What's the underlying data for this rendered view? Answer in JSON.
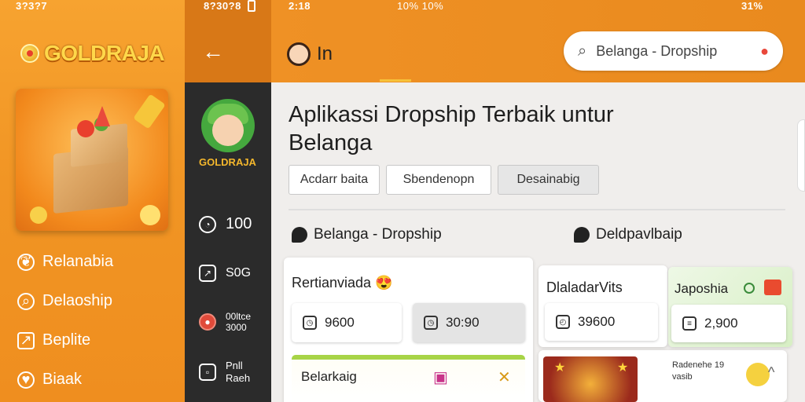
{
  "status": {
    "left_time": "3?3?7",
    "mid_time": "8?30?8",
    "main_time": "2:18",
    "main_indicators": "10%    10%",
    "right_battery": "31%"
  },
  "left_panel": {
    "brand": "GOLDRAJA",
    "menu": [
      {
        "label": "Relanabia",
        "icon": "leaf-icon"
      },
      {
        "label": "Delaoship",
        "icon": "search-icon"
      },
      {
        "label": "Beplite",
        "icon": "edit-icon"
      },
      {
        "label": "Biaak",
        "icon": "heart-icon"
      }
    ]
  },
  "dark_sidebar": {
    "brand": "GOLDRAJA",
    "items": [
      {
        "label": "100",
        "icon": "timer-icon"
      },
      {
        "label": "S0G",
        "icon": "edit-icon"
      },
      {
        "label": "00ltce\n3000",
        "icon": "record-icon"
      },
      {
        "label": "Pnll\nRaeh",
        "icon": "window-icon"
      }
    ]
  },
  "header": {
    "logo_text": "In",
    "search_value": "Belanga - Dropship"
  },
  "main": {
    "title": "Aplikassi Dropship Terbaik untur Belanga",
    "chips": [
      "Acdarr baita",
      "Sbendenopn",
      "Desainabig"
    ],
    "sections": [
      "Belanga - Dropship",
      "Deldpavlbaip"
    ]
  },
  "cards": {
    "left_card": {
      "title": "Rertianviada",
      "emoji": "😍",
      "pills": [
        "9600",
        "30:90"
      ],
      "sub_title": "Belarkaig"
    },
    "right_card_a": {
      "title": "DlaladarVits",
      "pill": "39600"
    },
    "right_card_b": {
      "title": "Japoshia",
      "pill": "2,900"
    },
    "right_card_c": {
      "text": "Radenehe 19\nvasib"
    }
  }
}
